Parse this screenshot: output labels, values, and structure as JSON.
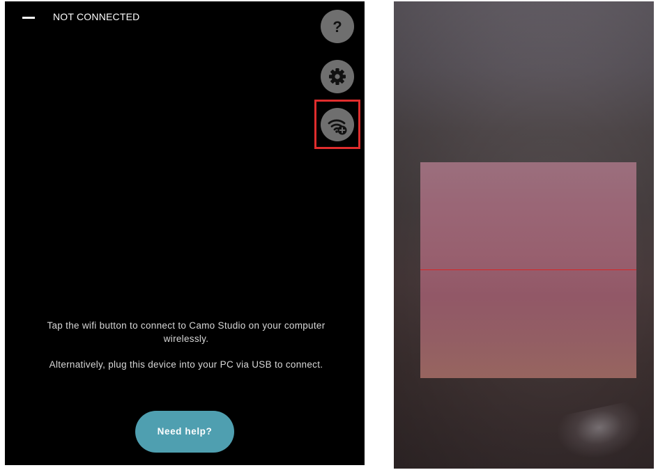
{
  "app": {
    "status": "NOT CONNECTED",
    "menu_icon": "menu-dash-icon"
  },
  "toolbar": {
    "help_label": "?",
    "help_icon": "question-mark-icon",
    "settings_icon": "gear-icon",
    "wifi_icon": "wifi-add-icon"
  },
  "instructions": {
    "wifi": "Tap the wifi button to connect to Camo Studio on your computer wirelessly.",
    "usb": "Alternatively, plug this device into your PC via USB to connect."
  },
  "help_button": {
    "label": "Need help?"
  },
  "colors": {
    "app_background": "#000000",
    "round_button": "#6f6f6f",
    "highlight": "#e02d2d",
    "help_button": "#4f9fb0",
    "scan_line": "#d92424"
  }
}
